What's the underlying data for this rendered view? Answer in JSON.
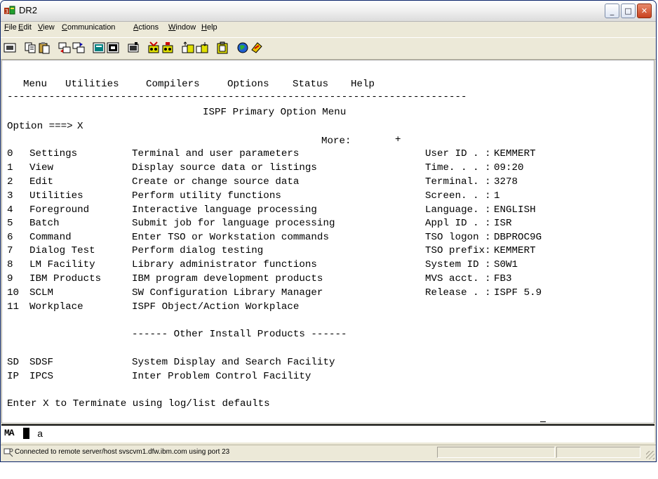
{
  "window": {
    "title": "DR2"
  },
  "menubar": {
    "items": [
      "File",
      "Edit",
      "View",
      "Communication",
      "Actions",
      "Window",
      "Help"
    ]
  },
  "terminal": {
    "action_bar": [
      "Menu",
      "Utilities",
      "Compilers",
      "Options",
      "Status",
      "Help"
    ],
    "separator": "-----------------------------------------------------------------------------",
    "panel_title": "ISPF Primary Option Menu",
    "command_prompt": "Option ===>",
    "command_value": "X",
    "more_label": "More:",
    "more_indicator": "+",
    "options": [
      {
        "code": "0",
        "name": "Settings",
        "desc": "Terminal and user parameters"
      },
      {
        "code": "1",
        "name": "View",
        "desc": "Display source data or listings"
      },
      {
        "code": "2",
        "name": "Edit",
        "desc": "Create or change source data"
      },
      {
        "code": "3",
        "name": "Utilities",
        "desc": "Perform utility functions"
      },
      {
        "code": "4",
        "name": "Foreground",
        "desc": "Interactive language processing"
      },
      {
        "code": "5",
        "name": "Batch",
        "desc": "Submit job for language processing"
      },
      {
        "code": "6",
        "name": "Command",
        "desc": "Enter TSO or Workstation commands"
      },
      {
        "code": "7",
        "name": "Dialog Test",
        "desc": "Perform dialog testing"
      },
      {
        "code": "8",
        "name": "LM Facility",
        "desc": "Library administrator functions"
      },
      {
        "code": "9",
        "name": "IBM Products",
        "desc": "IBM program development products"
      },
      {
        "code": "10",
        "name": "SCLM",
        "desc": "SW Configuration Library Manager"
      },
      {
        "code": "11",
        "name": "Workplace",
        "desc": "ISPF Object/Action Workplace"
      }
    ],
    "info": [
      {
        "label": "User ID . :",
        "value": "KEMMERT"
      },
      {
        "label": "Time. . . :",
        "value": "09:20"
      },
      {
        "label": "Terminal. :",
        "value": "3278"
      },
      {
        "label": "Screen. . :",
        "value": "1"
      },
      {
        "label": "Language. :",
        "value": "ENGLISH"
      },
      {
        "label": "Appl ID . :",
        "value": "ISR"
      },
      {
        "label": "TSO logon :",
        "value": "DBPROC9G"
      },
      {
        "label": "TSO prefix:",
        "value": "KEMMERT"
      },
      {
        "label": "System ID :",
        "value": "S0W1"
      },
      {
        "label": "MVS acct. :",
        "value": "FB3"
      },
      {
        "label": "Release . :",
        "value": "ISPF 5.9"
      }
    ],
    "other_header": "------ Other Install Products ------",
    "other": [
      {
        "code": "SD",
        "name": "SDSF",
        "desc": "System Display and Search Facility"
      },
      {
        "code": "IP",
        "name": "IPCS",
        "desc": "Inter Problem Control Facility"
      }
    ],
    "footer": "Enter X to Terminate using log/list defaults"
  },
  "oia": {
    "mode": "MA",
    "field": "a"
  },
  "status": {
    "text": "Connected to remote server/host svscvm1.dfw.ibm.com using port 23"
  },
  "colors": {
    "title_border": "#0a246a",
    "close_button": "#c8411e",
    "chrome": "#ece9d8"
  },
  "icons": [
    "app-icon",
    "print-icon",
    "copy-icon",
    "paste-icon",
    "send-icon",
    "receive-icon",
    "display-icon",
    "keyboard-icon",
    "macro-icon",
    "record-icon",
    "play-icon",
    "transfer-up-icon",
    "transfer-down-icon",
    "clipboard-icon",
    "globe-icon",
    "connect-icon",
    "status-connection-icon"
  ]
}
